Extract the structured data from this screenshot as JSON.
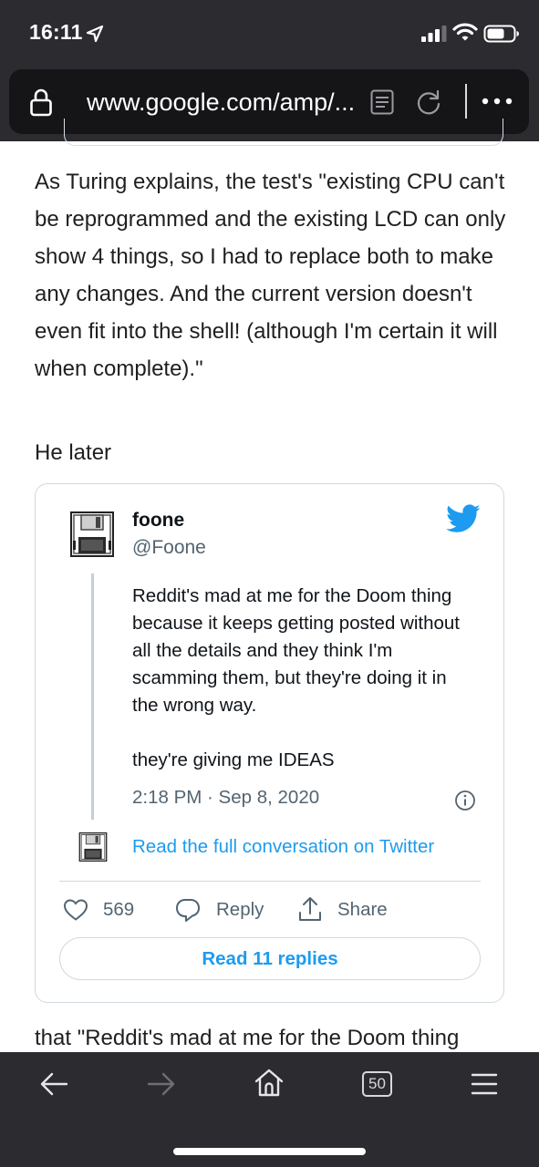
{
  "status_bar": {
    "time": "16:11",
    "icons": [
      "location-arrow-icon",
      "signal-icon",
      "wifi-icon",
      "battery-icon"
    ]
  },
  "address_bar": {
    "url": "www.google.com/amp/...",
    "icons": [
      "lock-icon",
      "reader-mode-icon",
      "reload-icon",
      "more-icon"
    ]
  },
  "article": {
    "paragraph_1": "As Turing explains, the test's \"existing CPU can't be reprogrammed and the existing LCD can only show 4 things, so I had to replace both to make any changes. And the current version doesn't even fit into the shell! (although I'm certain it will when complete).\"",
    "paragraph_2": "He later",
    "paragraph_3": "that \"Reddit's mad at me for the Doom thing"
  },
  "tweet": {
    "author_name": "foone",
    "author_handle": "@Foone",
    "text": "Reddit's mad at me for the Doom thing because it keeps getting posted without all the details and they think I'm scamming them, but they're doing it in the wrong way.\n\nthey're giving me IDEAS",
    "timestamp": "2:18 PM · Sep 8, 2020",
    "full_conversation_link": "Read the full conversation on Twitter",
    "like_count": "569",
    "reply_label": "Reply",
    "share_label": "Share",
    "read_replies_button": "Read 11 replies",
    "colors": {
      "link_blue": "#1d9bf0",
      "secondary_text": "#536471",
      "border": "#cfd9de"
    }
  },
  "toolbar": {
    "tab_count": "50",
    "icons": [
      "back-arrow-icon",
      "forward-arrow-icon",
      "home-icon",
      "tabs-icon",
      "menu-icon"
    ]
  },
  "theme": {
    "chrome_bg": "#2b2b30",
    "url_field_bg": "#151518",
    "text": "#1f1f1f"
  }
}
